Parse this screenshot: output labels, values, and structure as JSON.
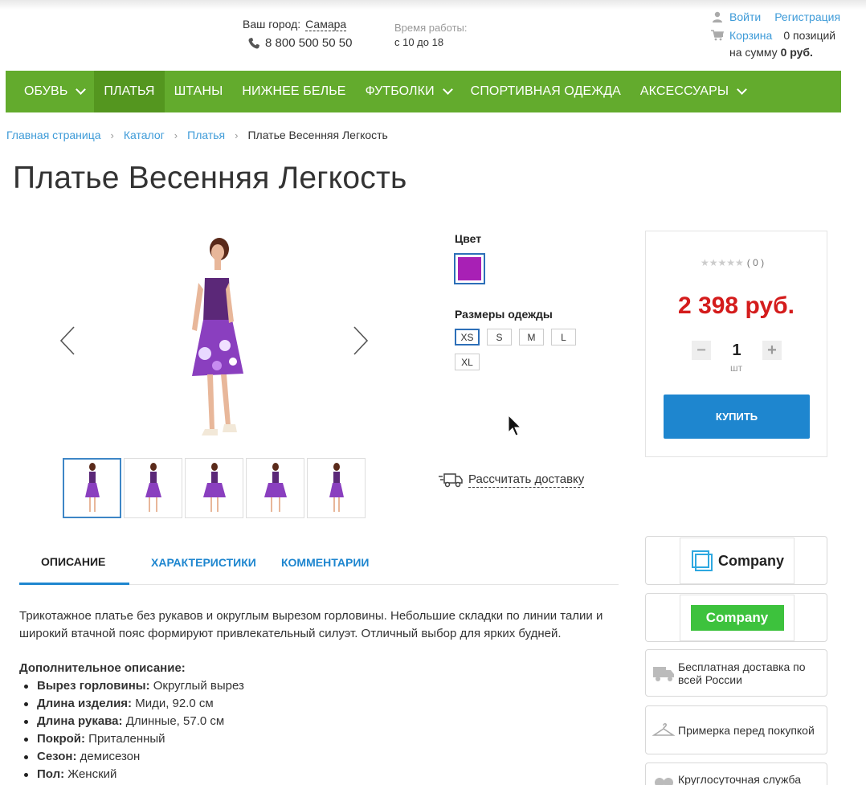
{
  "header": {
    "city_label": "Ваш город:",
    "city": "Самара",
    "phone": "8 800 500 50 50",
    "hours_label": "Время работы:",
    "hours": "с 10 до 18",
    "login": "Войти",
    "register": "Регистрация",
    "cart": "Корзина",
    "cart_count": "0 позиций",
    "sum_prefix": "на сумму",
    "sum_value": "0 руб."
  },
  "nav": {
    "items": [
      {
        "label": "ОБУВЬ"
      },
      {
        "label": "ПЛАТЬЯ"
      },
      {
        "label": "ШТАНЫ"
      },
      {
        "label": "НИЖНЕЕ БЕЛЬЕ"
      },
      {
        "label": "ФУТБОЛКИ"
      },
      {
        "label": "СПОРТИВНАЯ ОДЕЖДА"
      },
      {
        "label": "АКСЕССУАРЫ"
      }
    ],
    "active_color": "#54961f",
    "bar_color": "#63ab2d"
  },
  "breadcrumb": {
    "items": [
      "Главная страница",
      "Каталог",
      "Платья"
    ],
    "current": "Платье Весенняя Легкость"
  },
  "product": {
    "title": "Платье Весенняя Легкость",
    "color_label": "Цвет",
    "color_value": "#a820b5",
    "size_label": "Размеры одежды",
    "sizes": [
      "XS",
      "S",
      "M",
      "L",
      "XL"
    ],
    "selected_size": "XS",
    "delivery_link": "Рассчитать доставку",
    "rating_count": "( 0 )",
    "price": "2 398 руб.",
    "quantity": "1",
    "unit": "шт",
    "buy_label": "КУПИТЬ",
    "thumbnail_count": 5
  },
  "tabs": {
    "description": "ОПИСАНИЕ",
    "specs": "ХАРАКТЕРИСТИКИ",
    "comments": "КОММЕНТАРИИ"
  },
  "description": {
    "text": "Трикотажное платье без рукавов и округлым вырезом горловины. Небольшие складки по линии талии и широкий втачной пояс формируют привлекательный силуэт. Отличный выбор для ярких будней.",
    "extra_title": "Дополнительное описание:",
    "props": [
      {
        "name": "Вырез горловины:",
        "value": "Округлый вырез"
      },
      {
        "name": "Длина изделия:",
        "value": "Миди, 92.0 см"
      },
      {
        "name": "Длина рукава:",
        "value": "Длинные, 57.0 см"
      },
      {
        "name": "Покрой:",
        "value": "Приталенный"
      },
      {
        "name": "Сезон:",
        "value": "демисезон"
      },
      {
        "name": "Пол:",
        "value": "Женский"
      }
    ]
  },
  "sidebar": {
    "logo1": "Company",
    "logo2": "Company",
    "free_delivery": "Бесплатная доставка по всей России",
    "fitting": "Примерка перед покупкой",
    "support": "Круглосуточная служба"
  }
}
